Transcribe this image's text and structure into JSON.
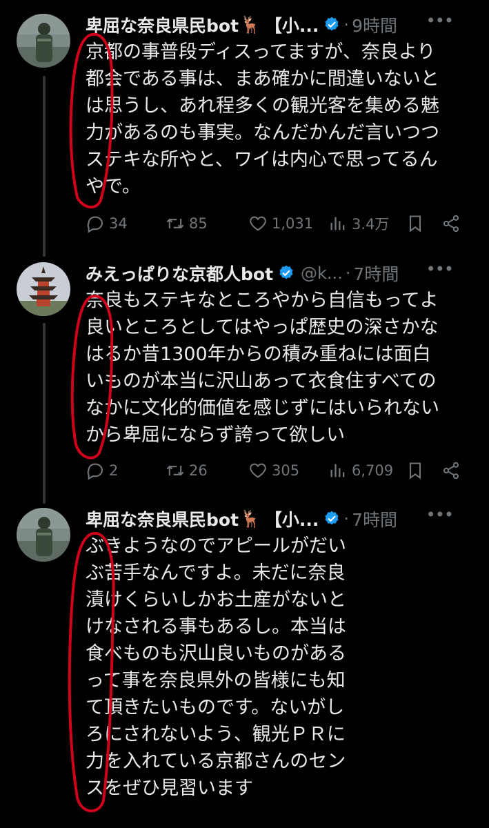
{
  "colors": {
    "background": "#000000",
    "text": "#e7e9ea",
    "muted": "#71767b",
    "verified": "#1d9bf0",
    "annotation": "#d0021b"
  },
  "tweets": [
    {
      "name": "卑屈な奈良県民bot",
      "bracket": "【小...",
      "handle": "",
      "time": "9時間",
      "text": "京都の事普段ディスってますが、奈良より\n都会である事は、まあ確かに間違いないと\nは思うし、あれ程多くの観光客を集める魅\n力があるのも事実。なんだかんだ言いつつ\nステキな所やと、ワイは内心で思ってるん\nやで。",
      "replies": "34",
      "retweets": "85",
      "likes": "1,031",
      "views": "3.4万"
    },
    {
      "name": "みえっぱりな京都人bot",
      "bracket": "",
      "handle": "@k...",
      "time": "7時間",
      "text": "奈良もステキなところやから自信もってよ\n良いところとしてはやっぱ歴史の深さかな\nはるか昔1300年からの積み重ねには面白\nいものが本当に沢山あって衣食住すべての\nなかに文化的価値を感じずにはいられない\nから卑屈にならず誇って欲しい",
      "replies": "2",
      "retweets": "26",
      "likes": "305",
      "views": "6,709"
    },
    {
      "name": "卑屈な奈良県民bot",
      "bracket": "【小...",
      "handle": "",
      "time": "7時間",
      "text": "ぶきようなのでアピールがだい\nぶ苦手なんですよ。未だに奈良\n漬けくらいしかお土産がないと\nけなされる事もあるし。本当は\n食べものも沢山良いものがある\nって事を奈良県外の皆様にも知\nて頂きたいものです。ないがし\nろにされないよう、観光ＰＲに\n力を入れている京都さんのセン\nスをぜひ見習います"
    }
  ]
}
